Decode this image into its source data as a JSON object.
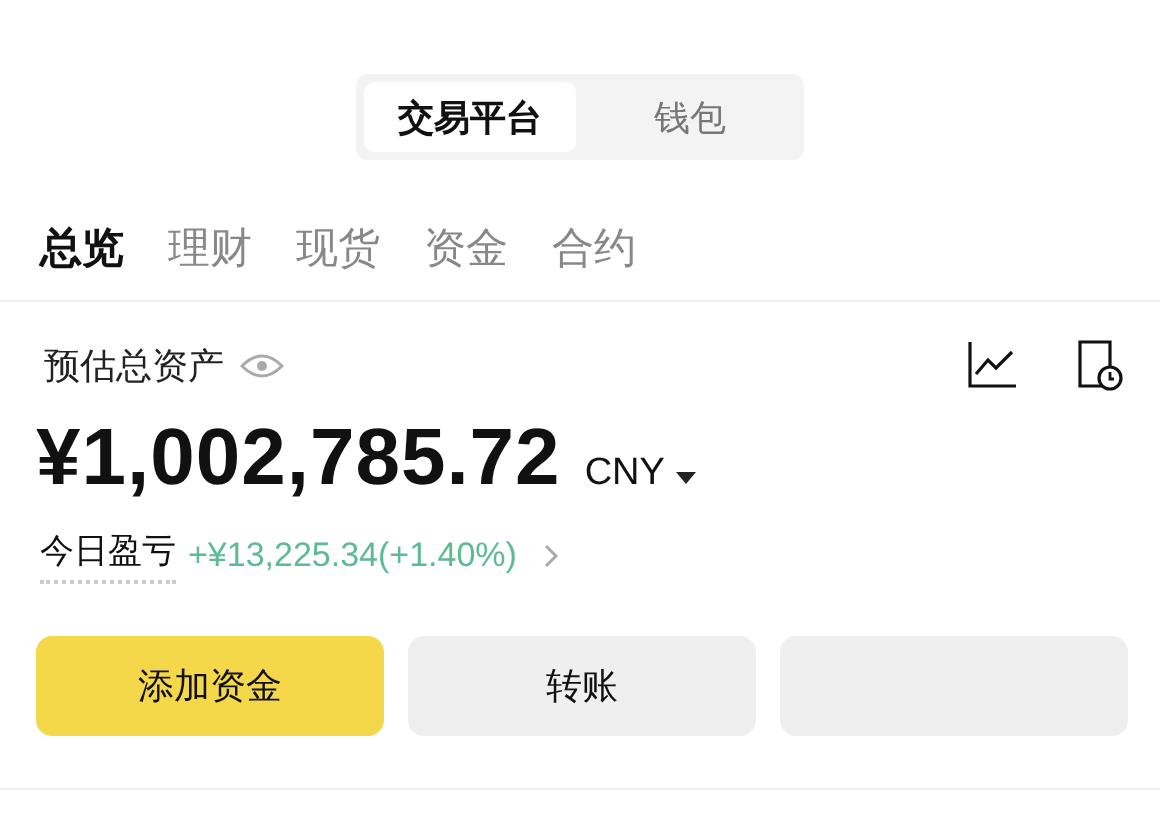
{
  "segment": [
    {
      "label": "交易平台",
      "selected": true
    },
    {
      "label": "钱包",
      "selected": false
    }
  ],
  "tabs": [
    {
      "label": "总览",
      "selected": true
    },
    {
      "label": "理财",
      "selected": false
    },
    {
      "label": "现货",
      "selected": false
    },
    {
      "label": "资金",
      "selected": false
    },
    {
      "label": "合约",
      "selected": false
    }
  ],
  "summary": {
    "label": "预估总资产",
    "amount": "¥1,002,785.72",
    "currency": "CNY",
    "pnl_label": "今日盈亏",
    "pnl_value": "+¥13,225.34(+1.40%)"
  },
  "buttons": [
    {
      "kind": "primary",
      "label": "添加资金"
    },
    {
      "kind": "secondary",
      "label": "转账"
    },
    {
      "kind": "secondary"
    }
  ]
}
